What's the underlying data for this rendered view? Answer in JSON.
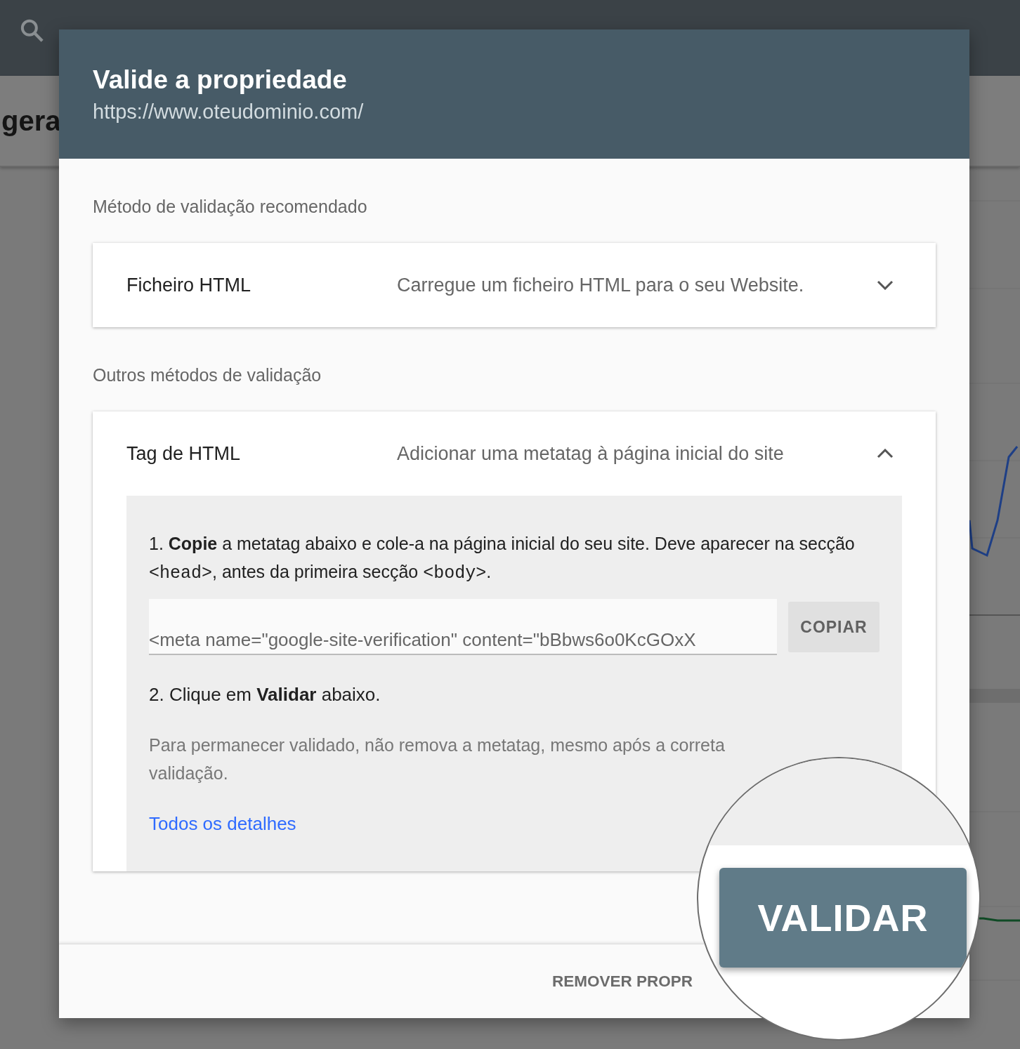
{
  "page": {
    "heading": "gera"
  },
  "dialog": {
    "title": "Valide a propriedade",
    "subtitle": "https://www.oteudominio.com/",
    "sections": [
      {
        "heading": "Método de validação recomendado",
        "methods": [
          {
            "title": "Ficheiro HTML",
            "description": "Carregue um ficheiro HTML para o seu Website.",
            "expanded": false
          }
        ]
      },
      {
        "heading": "Outros métodos de validação",
        "methods": [
          {
            "title": "Tag de HTML",
            "description": "Adicionar uma metatag à página inicial do site",
            "expanded": true,
            "details": {
              "step_1": [
                {
                  "kind": "text",
                  "text": "1. **Copie** a metatag abaixo e cole-a na página inicial do seu site. Deve aparecer na secção "
                },
                {
                  "kind": "code",
                  "text": "<head>"
                },
                {
                  "kind": "text",
                  "text": ", antes da primeira secção "
                },
                {
                  "kind": "code",
                  "text": "<body>"
                },
                {
                  "kind": "text",
                  "text": "."
                }
              ],
              "meta_field": {
                "value": "<meta name=\"google-site-verification\" content=\"bBbws6o0KcGOxX"
              },
              "copy_button": "COPIAR",
              "step_2": "2. Clique em **Validar** abaixo.",
              "note": "Para permanecer validado, não remova a metatag, mesmo após a correta validação.",
              "link": "Todos os detalhes"
            }
          }
        ]
      }
    ],
    "footer": {
      "remove_button": "REMOVER PROPR"
    },
    "magnifier": {
      "validate_button": "VALIDAR"
    }
  }
}
